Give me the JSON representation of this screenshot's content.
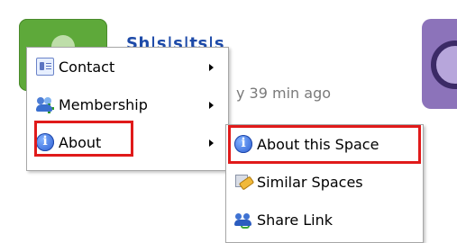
{
  "background": {
    "space_title": "Sh|s|s|ts|s",
    "last_activity": "y 39 min ago"
  },
  "context_menu": {
    "items": [
      {
        "label": "Contact",
        "icon": "contact-card-icon",
        "has_submenu": true
      },
      {
        "label": "Membership",
        "icon": "members-icon",
        "has_submenu": true
      },
      {
        "label": "About",
        "icon": "info-icon",
        "has_submenu": true,
        "active": true
      }
    ]
  },
  "submenu": {
    "items": [
      {
        "label": "About this Space",
        "icon": "info-icon",
        "active": true
      },
      {
        "label": "Similar Spaces",
        "icon": "similar-spaces-icon"
      },
      {
        "label": "Share Link",
        "icon": "share-link-icon"
      }
    ]
  },
  "colors": {
    "highlight": "#e01a1a",
    "menu_border": "#a7a7a7",
    "title_link": "#1d4aa8"
  }
}
